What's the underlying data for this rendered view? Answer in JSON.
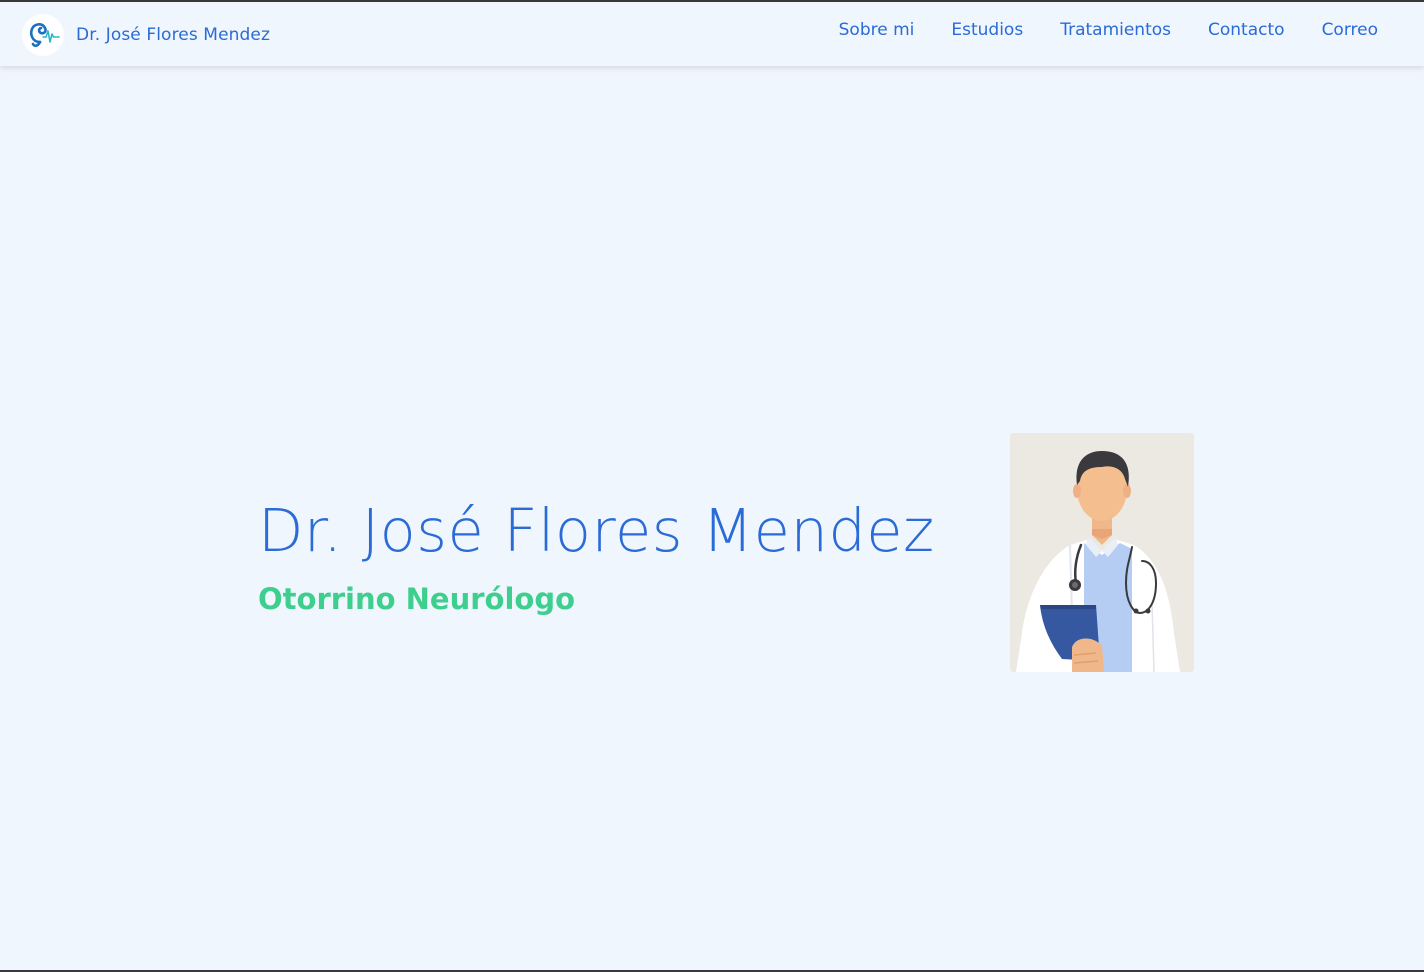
{
  "navbar": {
    "brand_name": "Dr. José Flores Mendez",
    "links": [
      {
        "label": "Sobre mi"
      },
      {
        "label": "Estudios"
      },
      {
        "label": "Tratamientos"
      },
      {
        "label": "Contacto"
      },
      {
        "label": "Correo"
      }
    ]
  },
  "hero": {
    "title": "Dr. José Flores Mendez",
    "subtitle": "Otorrino Neurólogo",
    "image": "doctor-illustration"
  },
  "colors": {
    "background": "#f0f6fe",
    "primary": "#2a6bd6",
    "accent": "#3ecf8e"
  }
}
